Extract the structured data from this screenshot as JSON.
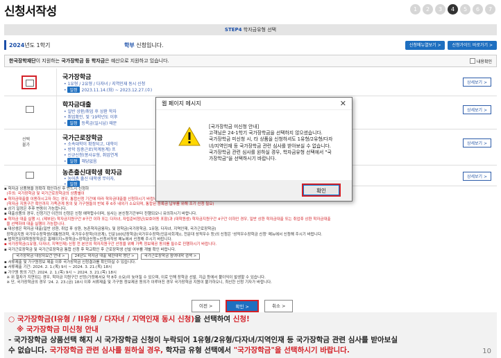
{
  "title": "신청서작성",
  "steps": [
    "1",
    "2",
    "3",
    "4",
    "5",
    "6",
    "7"
  ],
  "active_step": 3,
  "step_bar": {
    "step": "STEP4",
    "label": "학자금유형 선택"
  },
  "year_row": {
    "year": "2024",
    "year_suffix": "년도 1학기",
    "level": "학부",
    "level_suffix": "신청입니다.",
    "btn_menu": "신청메뉴열보기 >",
    "btn_guide": "신청가이드 바로가기 >"
  },
  "notice": {
    "prefix": "한국장학재단",
    "mid": "이 지원하는",
    "bold": "국가장학금 등 학자금",
    "suffix": "은 예산으로 지원하고 있습니다.",
    "check_label": "내용확인"
  },
  "rows": [
    {
      "name": "국가장학금",
      "line1": "1유형 / 2유형 / 다자녀 / 지역인재 동시 신청",
      "period": "일정",
      "line2": "2023.11.14.(화) ~ 2023.12.27.(수)",
      "detail": "상세보기 >"
    },
    {
      "name": "학자금대출",
      "line1": "일반 상환/취업 후 상환 학자",
      "period": "일정",
      "line2": "취업확인, 및 '19학년도 이후",
      "line3": "등록금(일시납) 때문",
      "detail": "상세보기 >"
    },
    {
      "name": "국가근로장학금",
      "select": "선택\n불가",
      "line1": "소속대학이 확정되고, 대학이",
      "line2": "방학 집중근로(학계동계) 프",
      "line3": "신규신청(봉사유형, 취업연계",
      "period": "일정",
      "line4": "해당없음",
      "detail": "상세보기 >"
    },
    {
      "name": "농촌출신대학생 학자금",
      "line1": "농어촌 출신 대학생 무이자,",
      "period": "일정",
      "detail": "상세보기 >"
    }
  ],
  "notes": [
    "학자금 상품명을 정확히 확인하신 후 반드시 신청하",
    "(주의: 국가장학금 및 국가근로장학금의 상품별이",
    "학자금대출을 이용하시고자 하는 경우, 통합신청 기간에 따라 학자금대출을 신청하시기 바랍니다.",
    "(학자금 지원구간 확인까지 가족관계 동의 및 가구원들의 반복 후 6주 내외가 소요되며, 통합된 등록금 납부를 위해 조기 신청 필요)",
    "상기 일정은 추후 변동이 가능합니다.",
    "대출상품의 경우, 신청기간 이전의 신청은 신청 예약합수이며, 심사는 본신청기간부터 진행되오니 유의하시기 바랍니다.",
    "학자금 대출 실행 시, (제부된) 학자금지원구간 8구간 이하 또는 다자녀, 자립준비청년(보호아동 포함)과 (대학원생) 학자금지원구간 4구간 이하인 경우, 일반 상환 학자금대출 또는 취업후 상환 학자금대출",
    "을 선택하여 대출 실행이 가능합니다.",
    "대상생은 학자금 대출(일반 상환, 취업 후 상환, 농촌학자금융자), 및 장학금(국가장학금, 1유형, 다자녀, 지역인재, 국가근로장학금)",
    "장학금지원 국가우수장학생(대통령과학, 국가우수장학(이공계), 인문100년장학금(국가우수장학(인문사회계)), 전문대 성적우수 등)의 신청은 '성적우수장학금 신청' 메뉴에서 신청해 주시기 바랍니다.",
    "법학전문대학원장학금은 홈페이지>장학금>장학금신청>신청서작성 메뉴에서 신청해 주시기 바랍니다.",
    "국가장학금(1유형, 다자녀, 지역인재) 신청 전 본인의 학자지원구간 산정을 위해 가족 정보제공 동의를 필수로 진행하시기 바랍니다.",
    "국가근로장학금 및 국가근로장학금 통합 신청 후 학교확인 후 근로장학생 선발 여부를 개별 확인 바랍니다.",
    "서류제출 및 가구원정보 제출 이후 국가장학금 신청결과를 확인하실 수 있습니다.",
    "서류제출 기간: 2024. 2. 1.(목) 9시 ~ 2024. 3. 21.(목) 18시",
    "가구원 동의 기간: 2024. 2. 1.(목) 9시 ~ 2024. 3. 21.(목) 18시",
    "※ 위 절차가 지연되는 경우, 학자금 지원구간 산정(가정에서요 약 8주 소요)이 늦어질 수 있으며, 이로 인해 장학금 선발, 지급 등에서 불이익이 발생할 수 있습니다.",
    "※ 단, 국가장학금의 경우 '24. 2. 23.(금) 18시 이후 서류제출 및 가구원 정보제공 동의가 이루어진 경우 국가장학금 지원이 불가하오니, 최신한 신청 기자가 바랍니다."
  ],
  "note_pills": [
    "국가장학금 대상자요건 안내 >",
    "24년도 학자금 대출 제한대학 명단 >",
    "국가근로장학금 참여대학 검색 >"
  ],
  "bottom_buttons": {
    "prev": "이전 >",
    "confirm": "확인 >",
    "cancel": "취소 >"
  },
  "dialog": {
    "title": "웹 페이지 메시지",
    "close": "✕",
    "message": [
      "[국가장학금 미신청 안내]",
      "고객님은 24-1학기 국가장학금을 선택하지 않으셨습니다.",
      "국가장학금 미신청 시, 타 상품을 신청하셔도 1유형/2유형/다자",
      "녀/지역인재 등 국가장학금 관련 심사를 받아보실 수 없습니다.",
      "국가장학금 관련 심사를 원하실 경우, 학자금유형 선택에서 \"국",
      "가장학금\"을 선택하시기 바랍니다."
    ],
    "ok": "확인"
  },
  "caption": {
    "l1_red": "○ 국가장학금(I유형 / II유형 / 다자녀 / 지역인재 동시 신청)",
    "l1_black": "을 선택하여 ",
    "l1_red2": "신청!",
    "l2": "※ 국가장학금 미신청 안내",
    "l3": "- 국가장학금 상품선택 해지 시 국가장학금 신청이 누락되어 1유형/2유형/다자녀/지역인재 등 국가장학금 관련 심사를 받아보실",
    "l4_a": "수 없습니다. ",
    "l4_red": "국가장학금 관련 심사를 원하실 경우,",
    "l4_b": " 학자금 유형 선택에서 ",
    "l4_red2": "\"국가장학금\"을 선택하시기 바랍니다.",
    "page": "10"
  }
}
